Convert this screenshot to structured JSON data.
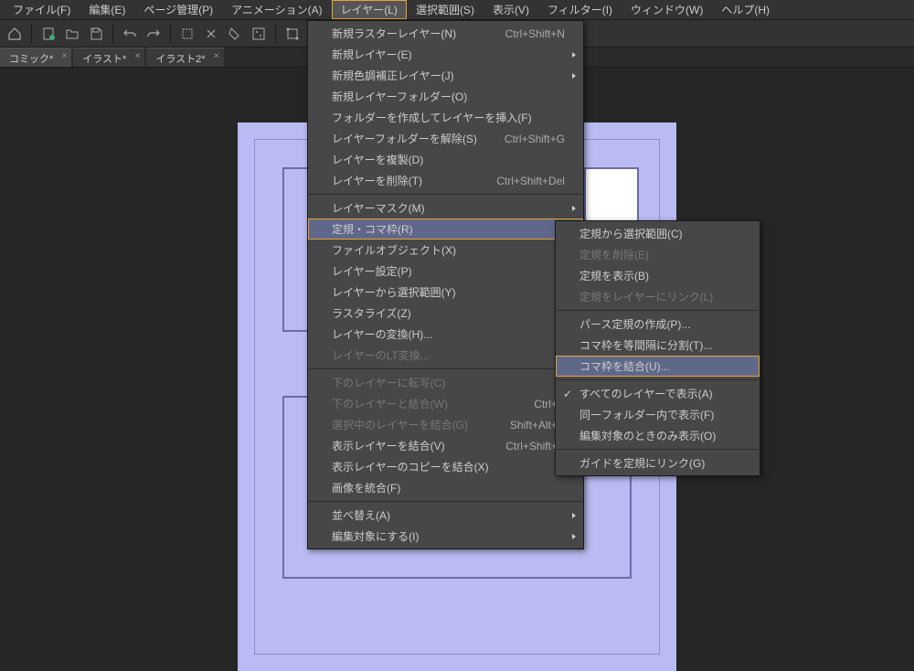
{
  "menubar": {
    "items": [
      {
        "label": "ファイル(F)"
      },
      {
        "label": "編集(E)"
      },
      {
        "label": "ページ管理(P)"
      },
      {
        "label": "アニメーション(A)"
      },
      {
        "label": "レイヤー(L)",
        "open": true
      },
      {
        "label": "選択範囲(S)"
      },
      {
        "label": "表示(V)"
      },
      {
        "label": "フィルター(I)"
      },
      {
        "label": "ウィンドウ(W)"
      },
      {
        "label": "ヘルプ(H)"
      }
    ]
  },
  "tabs": [
    {
      "label": "コミック*",
      "active": true
    },
    {
      "label": "イラスト*"
    },
    {
      "label": "イラスト2*"
    }
  ],
  "layer_menu": [
    {
      "label": "新規ラスターレイヤー(N)",
      "shortcut": "Ctrl+Shift+N"
    },
    {
      "label": "新規レイヤー(E)",
      "submenu": true
    },
    {
      "label": "新規色調補正レイヤー(J)",
      "submenu": true
    },
    {
      "label": "新規レイヤーフォルダー(O)"
    },
    {
      "label": "フォルダーを作成してレイヤーを挿入(F)"
    },
    {
      "label": "レイヤーフォルダーを解除(S)",
      "shortcut": "Ctrl+Shift+G"
    },
    {
      "label": "レイヤーを複製(D)"
    },
    {
      "label": "レイヤーを削除(T)",
      "shortcut": "Ctrl+Shift+Del"
    },
    {
      "sep": true
    },
    {
      "label": "レイヤーマスク(M)",
      "submenu": true
    },
    {
      "label": "定規・コマ枠(R)",
      "submenu": true,
      "highlighted": true
    },
    {
      "label": "ファイルオブジェクト(X)",
      "submenu": true
    },
    {
      "label": "レイヤー設定(P)",
      "submenu": true
    },
    {
      "label": "レイヤーから選択範囲(Y)",
      "submenu": true
    },
    {
      "label": "ラスタライズ(Z)"
    },
    {
      "label": "レイヤーの変換(H)..."
    },
    {
      "label": "レイヤーのLT変換...",
      "disabled": true
    },
    {
      "sep": true
    },
    {
      "label": "下のレイヤーに転写(C)",
      "disabled": true
    },
    {
      "label": "下のレイヤーと結合(W)",
      "shortcut": "Ctrl+E",
      "disabled": true
    },
    {
      "label": "選択中のレイヤーを結合(G)",
      "shortcut": "Shift+Alt+E",
      "disabled": true
    },
    {
      "label": "表示レイヤーを結合(V)",
      "shortcut": "Ctrl+Shift+E"
    },
    {
      "label": "表示レイヤーのコピーを結合(X)"
    },
    {
      "label": "画像を統合(F)"
    },
    {
      "sep": true
    },
    {
      "label": "並べ替え(A)",
      "submenu": true
    },
    {
      "label": "編集対象にする(I)",
      "submenu": true
    }
  ],
  "ruler_menu": [
    {
      "label": "定規から選択範囲(C)"
    },
    {
      "label": "定規を削除(E)",
      "disabled": true
    },
    {
      "label": "定規を表示(B)"
    },
    {
      "label": "定規をレイヤーにリンク(L)",
      "disabled": true
    },
    {
      "sep": true
    },
    {
      "label": "パース定規の作成(P)..."
    },
    {
      "label": "コマ枠を等間隔に分割(T)..."
    },
    {
      "label": "コマ枠を結合(U)...",
      "highlighted": true
    },
    {
      "sep": true
    },
    {
      "label": "すべてのレイヤーで表示(A)",
      "checked": true
    },
    {
      "label": "同一フォルダー内で表示(F)"
    },
    {
      "label": "編集対象のときのみ表示(O)"
    },
    {
      "sep": true
    },
    {
      "label": "ガイドを定規にリンク(G)"
    }
  ]
}
